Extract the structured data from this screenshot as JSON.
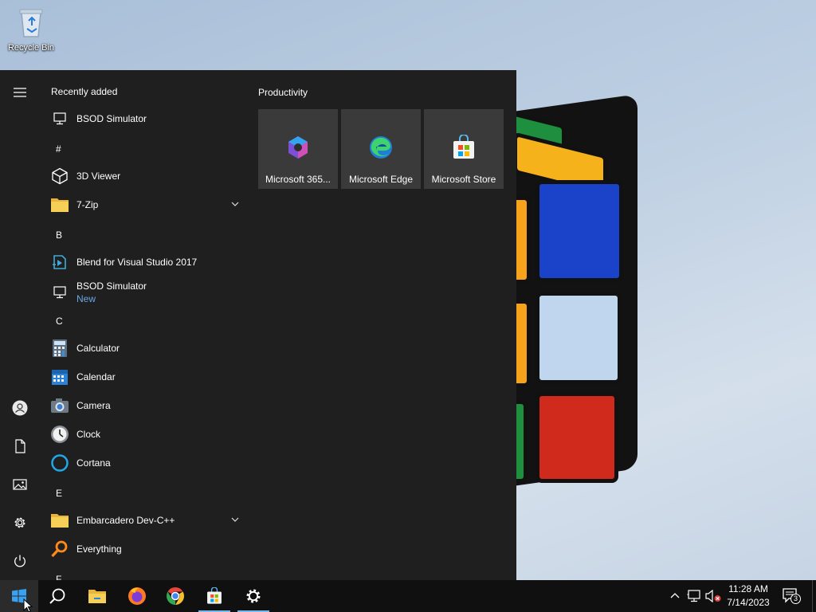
{
  "desktop": {
    "icons": [
      {
        "label": "Recycle Bin",
        "icon": "recycle-bin-icon"
      }
    ]
  },
  "start_menu": {
    "rail": [
      {
        "name": "expand",
        "icon": "hamburger-menu-icon"
      },
      {
        "name": "account",
        "icon": "user-account-icon"
      },
      {
        "name": "documents",
        "icon": "document-icon"
      },
      {
        "name": "pictures",
        "icon": "pictures-icon"
      },
      {
        "name": "settings",
        "icon": "gear-icon"
      },
      {
        "name": "power",
        "icon": "power-icon"
      }
    ],
    "recently_added_label": "Recently added",
    "recent_items": [
      {
        "label": "BSOD Simulator",
        "icon": "monitor-icon"
      }
    ],
    "sections": [
      {
        "letter": "#",
        "items": [
          {
            "label": "3D Viewer",
            "icon": "cube-icon"
          },
          {
            "label": "7-Zip",
            "icon": "folder-icon",
            "expandable": true
          }
        ]
      },
      {
        "letter": "B",
        "items": [
          {
            "label": "Blend for Visual Studio 2017",
            "icon": "blend-icon"
          },
          {
            "label": "BSOD Simulator",
            "sub": "New",
            "icon": "monitor-icon"
          }
        ]
      },
      {
        "letter": "C",
        "items": [
          {
            "label": "Calculator",
            "icon": "calculator-icon"
          },
          {
            "label": "Calendar",
            "icon": "calendar-icon"
          },
          {
            "label": "Camera",
            "icon": "camera-icon"
          },
          {
            "label": "Clock",
            "icon": "clock-icon"
          },
          {
            "label": "Cortana",
            "icon": "cortana-icon"
          }
        ]
      },
      {
        "letter": "E",
        "items": [
          {
            "label": "Embarcadero Dev-C++",
            "icon": "folder-icon",
            "expandable": true
          },
          {
            "label": "Everything",
            "icon": "magnifier-icon"
          }
        ]
      },
      {
        "letter": "F",
        "items": []
      }
    ],
    "tile_group": {
      "title": "Productivity",
      "tiles": [
        {
          "label": "Microsoft 365...",
          "icon": "microsoft-365-icon"
        },
        {
          "label": "Microsoft Edge",
          "icon": "edge-icon"
        },
        {
          "label": "Microsoft Store",
          "icon": "store-icon"
        }
      ]
    }
  },
  "taskbar": {
    "buttons": [
      {
        "name": "start",
        "icon": "windows-logo-icon"
      },
      {
        "name": "search",
        "icon": "search-icon"
      },
      {
        "name": "file-explorer",
        "icon": "file-explorer-icon"
      },
      {
        "name": "firefox",
        "icon": "firefox-icon"
      },
      {
        "name": "chrome",
        "icon": "chrome-icon"
      },
      {
        "name": "microsoft-store",
        "icon": "store-icon"
      },
      {
        "name": "settings",
        "icon": "gear-icon"
      }
    ],
    "tray": {
      "icons": [
        "chevron-up-icon",
        "network-icon",
        "volume-muted-icon"
      ],
      "time": "11:28 AM",
      "date": "7/14/2023",
      "notification_count": "3"
    }
  },
  "colors": {
    "accent": "#76b9ed",
    "start_bg": "#1f1f1f",
    "tile_bg": "#3a3a3a",
    "taskbar_bg": "#101010",
    "new_badge": "#69a7e4"
  }
}
